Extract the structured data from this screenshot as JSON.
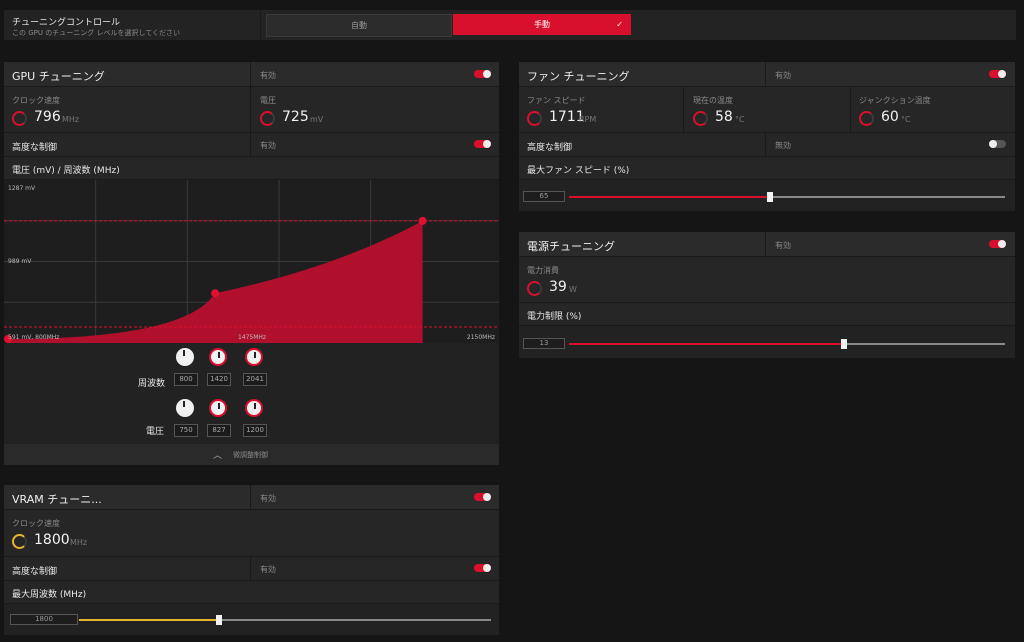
{
  "tuning_control": {
    "title": "チューニングコントロール",
    "subtitle": "この GPU のチューニング レベルを選択してください",
    "auto_label": "自動",
    "manual_label": "手動",
    "check": "✓"
  },
  "gpu_tuning": {
    "title": "GPU チューニング",
    "status": "有効",
    "enabled": true,
    "clock_label": "クロック速度",
    "clock_value": "796",
    "clock_unit": "MHz",
    "voltage_label": "電圧",
    "voltage_value": "725",
    "voltage_unit": "mV",
    "advanced_label": "高度な制御",
    "advanced_status": "有効",
    "advanced_enabled": true,
    "curve_label": "電圧 (mV) / 周波数 (MHz)",
    "freq_row_label": "周波数",
    "volt_row_label": "電圧",
    "freq_values": [
      "800",
      "1420",
      "2041"
    ],
    "volt_values": [
      "750",
      "827",
      "1200"
    ],
    "collapse_label": "微調整制御"
  },
  "chart_data": {
    "type": "area",
    "x_axis_labels": {
      "start": "591 mV, 800MHz",
      "mid": "1475MHz",
      "end": "2150MHz"
    },
    "y_axis_labels": {
      "top": "1287 mV",
      "mid": "989 mV"
    },
    "points": [
      {
        "x": 800,
        "y": 591
      },
      {
        "x": 1420,
        "y": 827
      },
      {
        "x": 2041,
        "y": 1200
      }
    ],
    "x_range": [
      800,
      2150
    ],
    "y_range": [
      591,
      1287
    ],
    "color": "#b0102b"
  },
  "vram_tuning": {
    "title": "VRAM チューニ...",
    "status": "有効",
    "enabled": true,
    "clock_label": "クロック速度",
    "clock_value": "1800",
    "clock_unit": "MHz",
    "advanced_label": "高度な制御",
    "advanced_status": "有効",
    "advanced_enabled": true,
    "max_freq_label": "最大周波数 (MHz)",
    "max_freq_value": "1800",
    "max_freq_fraction": 0.34
  },
  "fan_tuning": {
    "title": "ファン チューニング",
    "status": "有効",
    "enabled": true,
    "fan_speed_label": "ファン スピード",
    "fan_speed_value": "1711",
    "fan_speed_unit": "RPM",
    "temp_label": "現在の温度",
    "temp_value": "58",
    "temp_unit": "°C",
    "junction_label": "ジャンクション温度",
    "junction_value": "60",
    "junction_unit": "°C",
    "advanced_label": "高度な制御",
    "advanced_status": "無効",
    "advanced_enabled": false,
    "max_fan_label": "最大ファン スピード (%)",
    "max_fan_value": "65",
    "max_fan_fraction": 0.46
  },
  "power_tuning": {
    "title": "電源チューニング",
    "status": "有効",
    "enabled": true,
    "power_label": "電力消費",
    "power_value": "39",
    "power_unit": "W",
    "limit_label": "電力制限 (%)",
    "limit_value": "13",
    "limit_fraction": 0.63
  },
  "colors": {
    "accent": "#d9102d",
    "vram_accent": "#e6b52e"
  }
}
